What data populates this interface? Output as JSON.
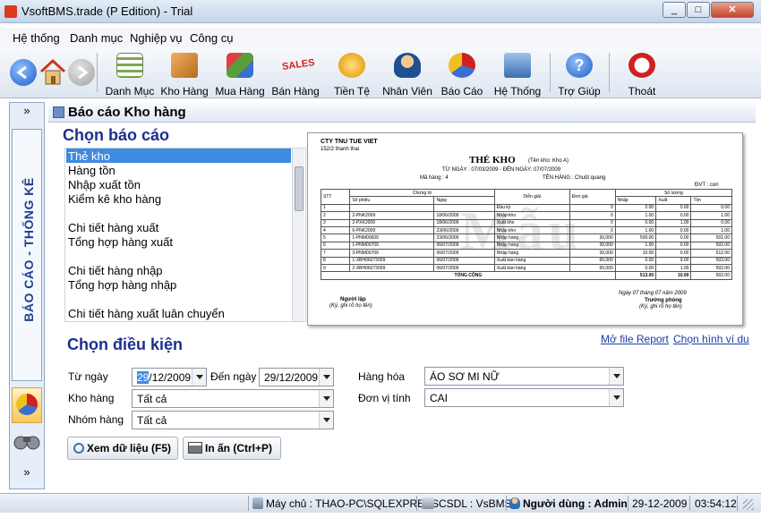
{
  "window": {
    "title": "VsoftBMS.trade (P Edition) - Trial",
    "controls": [
      "_",
      "□",
      "✕"
    ]
  },
  "menu": [
    "Hệ thống",
    "Danh mục",
    "Nghiệp vụ",
    "Công cụ"
  ],
  "toolbar": [
    {
      "label": "Danh Mục",
      "icon": "list-icon",
      "color": "#7aa84e"
    },
    {
      "label": "Kho Hàng",
      "icon": "box-icon",
      "color": "#d38a30"
    },
    {
      "label": "Mua Hàng",
      "icon": "cubes-icon",
      "color": "#5a9e3c"
    },
    {
      "label": "Bán Hàng",
      "icon": "sales-icon",
      "color": "#d6201a"
    },
    {
      "label": "Tiền Tệ",
      "icon": "coins-icon",
      "color": "#f0a010"
    },
    {
      "label": "Nhân Viên",
      "icon": "person-icon",
      "color": "#e0a040"
    },
    {
      "label": "Báo Cáo",
      "icon": "chart-icon",
      "color": "#3a6fd0"
    },
    {
      "label": "Hệ Thống",
      "icon": "network-icon",
      "color": "#4a8ac8"
    },
    {
      "label": "Trợ Giúp",
      "icon": "help-icon",
      "color": "#2f7ad8"
    },
    {
      "label": "Thoát",
      "icon": "exit-icon",
      "color": "#d02020"
    }
  ],
  "side": {
    "label": "BÁO CÁO - THỐNG KÊ",
    "expand": "»",
    "collapse": "»"
  },
  "header": {
    "title": "Báo cáo Kho hàng"
  },
  "select_report": {
    "heading": "Chọn báo cáo",
    "items": [
      "Thẻ kho",
      "Hàng tồn",
      "Nhập xuất tồn",
      "Kiểm kê kho hàng",
      "",
      "Chi tiết hàng xuất",
      "Tổng hợp hàng xuất",
      "",
      "Chi tiết hàng nhập",
      "Tổng hợp hàng nhập",
      "",
      "Chi tiết hàng xuất luân chuyển"
    ],
    "selected": 0
  },
  "preview": {
    "company": "CTY TNU TUE VIET",
    "address": "152/2 thanh thai",
    "title": "THẺ KHO",
    "store": "(Tên kho: Kho A)",
    "date_range": "TỪ NGÀY :  07/03/2009  -  ĐẾN NGÀY:  07/07/2009",
    "item_code": "Mã hàng : 4",
    "item_name": "TÊN HÀNG : Chuột quang",
    "unit": "ĐVT : con",
    "headers": [
      "STT",
      "Chứng từ",
      "Số phiếu",
      "Ngày",
      "Diễn giải",
      "Đơn giá",
      "Số lượng",
      "Nhập",
      "Xuất",
      "Tồn"
    ],
    "rows": [
      [
        "1",
        "",
        "",
        "Đầu kỳ",
        "0",
        "0.00",
        "0.00",
        "0.00"
      ],
      [
        "2",
        "2-PNK2009",
        "18/06/2009",
        "Nhập kho",
        "0",
        "1.00",
        "0.00",
        "1.00"
      ],
      [
        "3",
        "2-PXK2009",
        "18/06/2009",
        "Xuất kho",
        "0",
        "0.00",
        "1.00",
        "0.00"
      ],
      [
        "4",
        "6-PNK2009",
        "23/06/2009",
        "Nhập kho",
        "0",
        "1.00",
        "0.00",
        "1.00"
      ],
      [
        "5",
        "1-PNM00609",
        "23/06/2009",
        "Nhập hàng",
        "30,000",
        "500.00",
        "0.00",
        "501.00"
      ],
      [
        "6",
        "1-PNM00709",
        "06/07/2009",
        "Nhập hàng",
        "30,000",
        "1.00",
        "0.00",
        "502.00"
      ],
      [
        "7",
        "3-PNM00709",
        "06/07/2009",
        "Nhập hàng",
        "30,000",
        "10.00",
        "0.00",
        "512.00"
      ],
      [
        "8",
        "1-XBH06072009",
        "06/07/2009",
        "Xuất bán hàng",
        "60,000",
        "0.00",
        "9.00",
        "503.00"
      ],
      [
        "9",
        "2-XBH06072009",
        "06/07/2009",
        "Xuất bán hàng",
        "60,000",
        "0.00",
        "1.00",
        "502.00"
      ]
    ],
    "total_label": "TỔNG CỘNG",
    "total_in": "513.00",
    "total_out": "10.00",
    "total_bal": "502.00",
    "footer_date": "Ngày 07 tháng 07 năm 2009",
    "preparer": "Người lập",
    "preparer_note": "(Ký, ghi rõ họ tên)",
    "manager": "Trưởng phòng",
    "manager_note": "(Ký, ghi rõ họ tên)",
    "watermark": "Mẫu"
  },
  "links": {
    "open_report": "Mở file Report",
    "choose_sample": "Chọn hình ví du"
  },
  "conditions": {
    "heading": "Chọn điều kiện",
    "from_label": "Từ ngày",
    "from_day": "29",
    "from_rest": "/12/2009",
    "to_label": "Đến ngày",
    "to_value": "29/12/2009",
    "warehouse_label": "Kho hàng",
    "warehouse_value": "Tất cả",
    "group_label": "Nhóm hàng",
    "group_value": "Tất cả",
    "goods_label": "Hàng hóa",
    "goods_value": "ÁO SƠ MI NỮ",
    "unit_label": "Đơn vị tính",
    "unit_value": "CAI"
  },
  "buttons": {
    "view": "Xem dữ liệu (F5)",
    "print": "In ấn (Ctrl+P)"
  },
  "status": {
    "server": "Máy chủ : THAO-PC\\SQLEXPRESS",
    "db": "CSDL : VsBMS",
    "user": "Người dùng : Admin",
    "date": "29-12-2009",
    "time": "03:54:12"
  }
}
